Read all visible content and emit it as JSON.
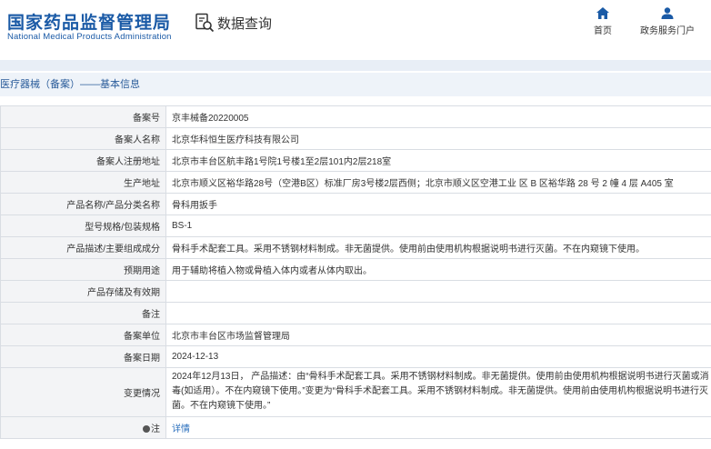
{
  "header": {
    "logo_cn": "国家药品监督管理局",
    "logo_en": "National Medical Products Administration",
    "query_title": "数据查询",
    "nav": {
      "home": "首页",
      "gov_portal": "政务服务门户"
    }
  },
  "breadcrumb": {
    "category": "医疗器械（备案）",
    "separator": "——",
    "section": "基本信息"
  },
  "rows": [
    {
      "label": "备案号",
      "value": "京丰械备20220005"
    },
    {
      "label": "备案人名称",
      "value": "北京华科恒生医疗科技有限公司"
    },
    {
      "label": "备案人注册地址",
      "value": "北京市丰台区航丰路1号院1号楼1至2层101内2层218室"
    },
    {
      "label": "生产地址",
      "value": "北京市顺义区裕华路28号（空港B区）标准厂房3号楼2层西侧；北京市顺义区空港工业 区 B 区裕华路 28 号 2 幢 4 层 A405 室"
    },
    {
      "label": "产品名称/产品分类名称",
      "value": "骨科用扳手"
    },
    {
      "label": "型号规格/包装规格",
      "value": "BS-1"
    },
    {
      "label": "产品描述/主要组成成分",
      "value": "骨科手术配套工具。采用不锈钢材料制成。非无菌提供。使用前由使用机构根据说明书进行灭菌。不在内窥镜下使用。"
    },
    {
      "label": "预期用途",
      "value": "用于辅助将植入物或骨植入体内或者从体内取出。"
    },
    {
      "label": "产品存储及有效期",
      "value": ""
    },
    {
      "label": "备注",
      "value": ""
    },
    {
      "label": "备案单位",
      "value": "北京市丰台区市场监督管理局"
    },
    {
      "label": "备案日期",
      "value": "2024-12-13"
    },
    {
      "label": "变更情况",
      "value": "2024年12月13日， 产品描述：由“骨科手术配套工具。采用不锈钢材料制成。非无菌提供。使用前由使用机构根据说明书进行灭菌或消毒(如适用）。不在内窥镜下使用。”变更为“骨科手术配套工具。采用不锈钢材料制成。非无菌提供。使用前由使用机构根据说明书进行灭菌。不在内窥镜下使用。”"
    },
    {
      "label": "注",
      "value": "详情"
    }
  ],
  "colors": {
    "brand": "#1a5aa6",
    "link": "#2a6fbd",
    "label_bg": "#f3f4f6",
    "border": "#d9dde3"
  },
  "icons": {
    "query": "search-document-icon",
    "home": "home-icon",
    "gov": "user-icon",
    "note": "pin-icon"
  }
}
